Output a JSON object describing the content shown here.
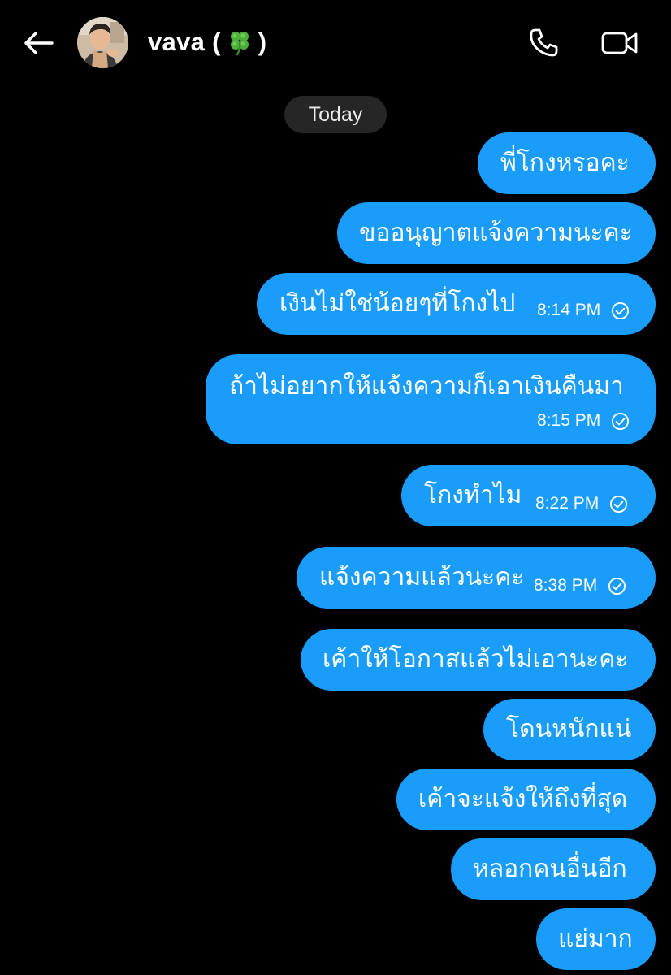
{
  "header": {
    "contact_name_pre": "vava (",
    "contact_name_post": ")",
    "contact_emoji": "four-leaf-clover",
    "back_icon": "arrow-left-icon",
    "call_icon": "phone-icon",
    "video_icon": "video-camera-icon"
  },
  "date_divider": "Today",
  "colors": {
    "background": "#000000",
    "bubble": "#1a9dfa",
    "pill": "#262626"
  },
  "messages": [
    {
      "text": "พี่โกงหรอคะ",
      "time": ""
    },
    {
      "text": "ขออนุญาตแจ้งความนะคะ",
      "time": ""
    },
    {
      "text": "เงินไม่ใช่น้อยๆที่โกงไป",
      "time": "8:14 PM",
      "status": "sent"
    },
    {
      "text": "ถ้าไม่อยากให้แจ้งความก็เอาเงินคืนมา",
      "time": "8:15 PM",
      "status": "sent"
    },
    {
      "text": "โกงทำไม",
      "time": "8:22 PM",
      "status": "sent"
    },
    {
      "text": "แจ้งความแล้วนะคะ",
      "time": "8:38 PM",
      "status": "sent"
    },
    {
      "text": "เค้าให้โอกาสแล้วไม่เอานะคะ",
      "time": ""
    },
    {
      "text": "โดนหนักแน่",
      "time": ""
    },
    {
      "text": "เค้าจะแจ้งให้ถึงที่สุด",
      "time": ""
    },
    {
      "text": "หลอกคนอื่นอีก",
      "time": ""
    },
    {
      "text": "แย่มาก",
      "time": ""
    }
  ]
}
